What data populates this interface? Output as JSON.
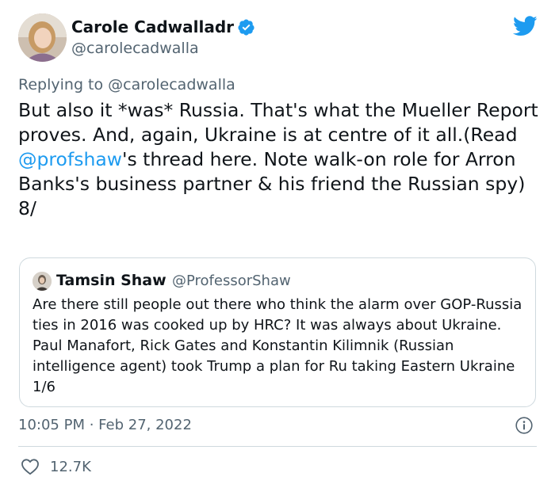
{
  "author": {
    "name": "Carole Cadwalladr",
    "handle": "@carolecadwalla"
  },
  "reply": {
    "prefix": "Replying to ",
    "handle": "@carolecadwalla"
  },
  "tweet": {
    "text_before": "But also it *was* Russia. That's what the Mueller Report proves. And, again, Ukraine is at centre of it all.(Read ",
    "mention": "@profshaw",
    "text_after": "'s thread here. Note walk-on role for Arron Banks's business partner & his friend the Russian spy)",
    "thread_marker": "8/"
  },
  "quote": {
    "name": "Tamsin Shaw",
    "handle": "@ProfessorShaw",
    "text": "Are there still people out there who think the alarm over GOP-Russia ties in 2016 was cooked up by HRC? It was always about Ukraine. Paul Manafort, Rick Gates and Konstantin Kilimnik (Russian intelligence agent) took Trump a plan for Ru taking Eastern Ukraine 1/6"
  },
  "meta": {
    "timestamp": "10:05 PM · Feb 27, 2022",
    "likes": "12.7K"
  },
  "icons": {
    "verified": "verified-badge-icon",
    "brand": "twitter-bird-icon",
    "info": "info-icon",
    "like": "heart-icon"
  },
  "colors": {
    "brand": "#1d9bf0",
    "text": "#0f1419",
    "secondary": "#536471",
    "border": "#cfd9de"
  }
}
